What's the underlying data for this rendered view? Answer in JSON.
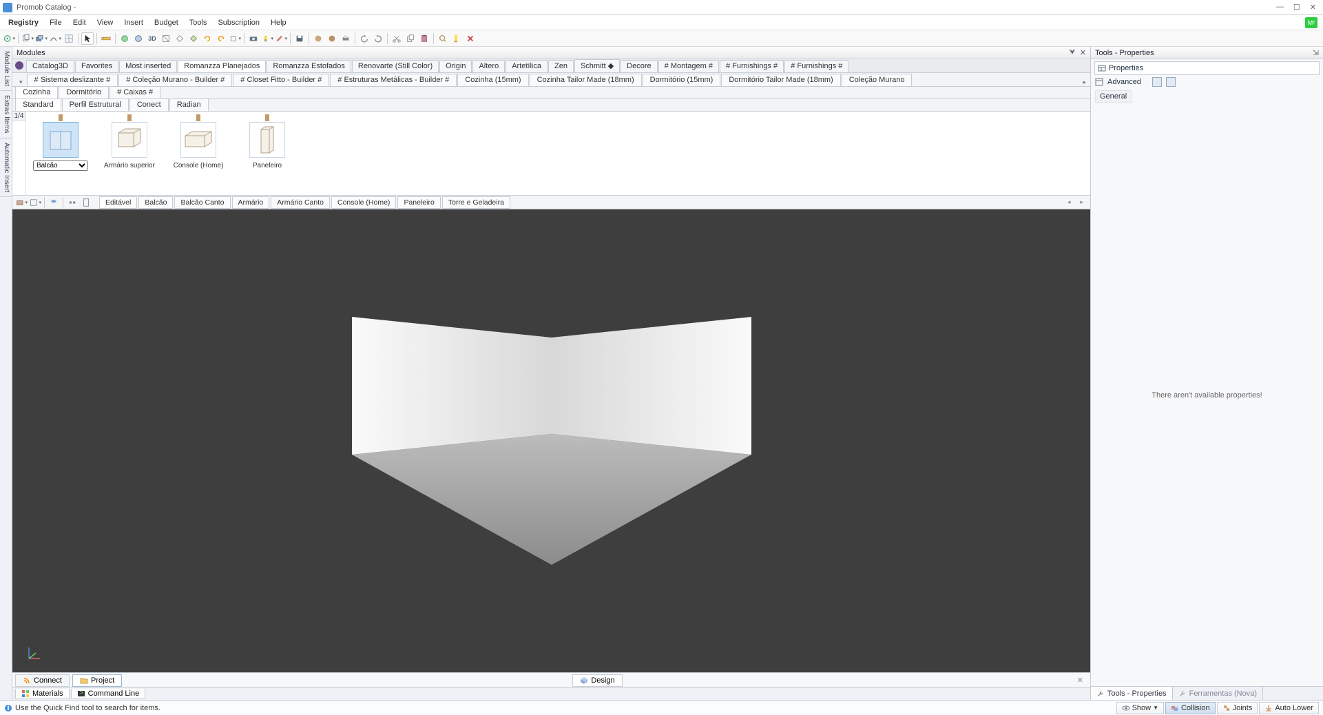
{
  "title": "Promob Catalog -",
  "menu": [
    "Registry",
    "File",
    "Edit",
    "View",
    "Insert",
    "Budget",
    "Tools",
    "Subscription",
    "Help"
  ],
  "badge": "M²",
  "panels": {
    "modules": "Modules",
    "tools_props": "Tools - Properties"
  },
  "vtabs": [
    "Module List",
    "Extras Items",
    "Automatic Insert"
  ],
  "catalog_tabs": [
    "Catalog3D",
    "Favorites",
    "Most inserted",
    "Romanzza Planejados",
    "Romanzza Estofados",
    "Renovarte (Still Color)",
    "Origin",
    "Altero",
    "Artetílica",
    "Zen",
    "Schmitt ◆",
    "Decore",
    "# Montagem #",
    "# Furnishings #",
    "# Furnishings #"
  ],
  "catalog_active": 3,
  "collection_tabs": [
    "# Sistema deslizante #",
    "# Coleção Murano - Builder #",
    "# Closet Fitto - Builder #",
    "# Estruturas Metálicas - Builder #",
    "Cozinha (15mm)",
    "Cozinha Tailor Made (18mm)",
    "Dormitório (15mm)",
    "Dormitório Tailor Made (18mm)",
    "Coleção Murano"
  ],
  "collection_tabs2": [
    "Cozinha",
    "Dormitório",
    "# Caixas #"
  ],
  "collection_tabs2_active": 0,
  "variant_tabs": [
    "Standard",
    "Perfil Estrutural",
    "Conect",
    "Radian"
  ],
  "variant_active": 0,
  "page": "1/4",
  "modules_items": [
    {
      "label": "Balcão",
      "select": true
    },
    {
      "label": "Armário superior"
    },
    {
      "label": "Console (Home)"
    },
    {
      "label": "Paneleiro"
    }
  ],
  "type_tabs": [
    "Editável",
    "Balcão",
    "Balcão Canto",
    "Armário",
    "Armário Canto",
    "Console (Home)",
    "Paneleiro",
    "Torre e Geladeira"
  ],
  "type_active": 0,
  "viewport_tabs": {
    "left": [
      {
        "label": "Connect",
        "icon": "rss"
      },
      {
        "label": "Project",
        "icon": "folder"
      }
    ],
    "center": {
      "label": "Design",
      "icon": "cube"
    }
  },
  "bottom_tabs": [
    "Materials",
    "Command Line"
  ],
  "properties": {
    "header": "Properties",
    "advanced": "Advanced",
    "general": "General",
    "empty": "There aren't available properties!"
  },
  "right_bottom_tabs": [
    "Tools - Properties",
    "Ferramentas (Nova)"
  ],
  "status": {
    "msg": "Use the Quick Find tool to search for items.",
    "show": "Show",
    "buttons": [
      "Collision",
      "Joints",
      "Auto Lower"
    ]
  }
}
